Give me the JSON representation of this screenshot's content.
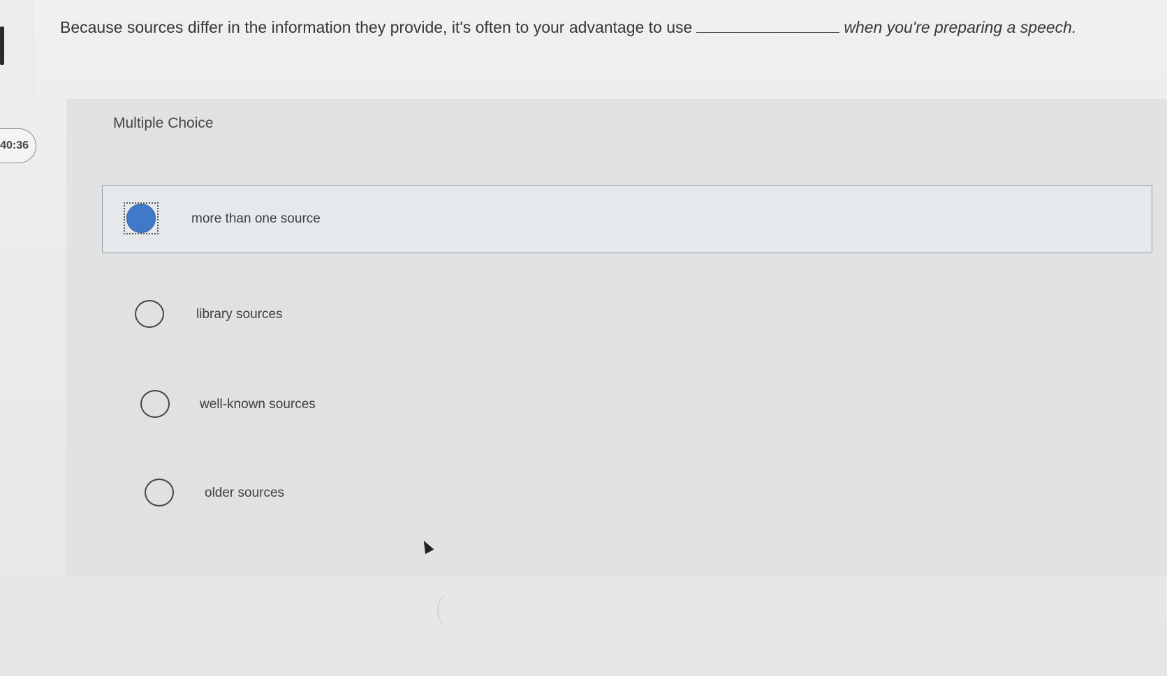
{
  "timer": {
    "text": "40:36"
  },
  "question": {
    "before": "Because sources differ in the information they provide, it's often to your advantage to use",
    "after": "when you're preparing a speech."
  },
  "card": {
    "label": "Multiple Choice",
    "options": [
      {
        "label": "more than one source",
        "selected": true
      },
      {
        "label": "library sources",
        "selected": false
      },
      {
        "label": "well-known sources",
        "selected": false
      },
      {
        "label": "older sources",
        "selected": false
      }
    ]
  },
  "colors": {
    "selected_radio": "#3f79c8",
    "selected_border": "#8c9fae"
  }
}
